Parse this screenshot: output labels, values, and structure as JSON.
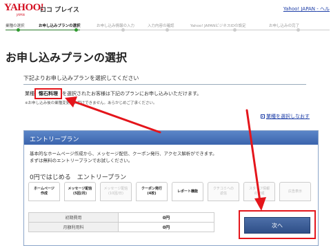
{
  "header": {
    "logo_main": "YAHOO!",
    "logo_sub": "JAPAN",
    "service_name": "ロコ プレイス",
    "yjapan_link": "Yahoo! JAPAN",
    "help_link": "- ヘル"
  },
  "steps": [
    {
      "label": "業種の選択",
      "state": "done"
    },
    {
      "label": "お申し込みプランの選択",
      "state": "current"
    },
    {
      "label": "お申し込み情報の入力",
      "state": "todo"
    },
    {
      "label": "入力内容の確認",
      "state": "todo"
    },
    {
      "label": "Yahoo! JAPANビジネスIDの設定",
      "state": "todo"
    },
    {
      "label": "お申し込みの完了",
      "state": "todo"
    }
  ],
  "page_title": "お申し込みプランの選択",
  "section_heading": "下記よりお申し込みプランを選択してください",
  "industry": {
    "prefix": "業種",
    "value": "懐石料理",
    "suffix": "を選択されたお客様は下記のプランにお申し込みいただけます。",
    "note": "※お申し込み後の業種変更はお受けできません。あらかじめご了承ください。"
  },
  "reselect_link": "業種を選択しなおす",
  "plan": {
    "header": "エントリープラン",
    "desc_line1": "基本的なホームページ作成から、メッセージ配信、クーポン発行、アクセス解析ができます。",
    "desc_line2": "まずは無料のエントリープランでお試しください。",
    "name": "0円ではじめる　エントリープラン",
    "features": [
      {
        "line1": "ホームページ",
        "line2": "作成",
        "enabled": true
      },
      {
        "line1": "メッセージ配信",
        "line2": "(5回/月)",
        "enabled": true
      },
      {
        "line1": "メッセージ配信",
        "line2": "(10回/日)",
        "enabled": false
      },
      {
        "line1": "クーポン発行",
        "line2": "(4枚)",
        "enabled": true
      },
      {
        "line1": "レポート機能",
        "line2": "",
        "enabled": true
      },
      {
        "line1": "クチコミへの",
        "line2": "返信",
        "enabled": false
      },
      {
        "line1": "スタッフ情報",
        "line2": "の作成",
        "enabled": false
      },
      {
        "line1": "広告表示",
        "line2": "",
        "enabled": false
      }
    ],
    "fees": [
      {
        "label": "初期費用",
        "value": "0円"
      },
      {
        "label": "月額利用料",
        "value": "0円"
      }
    ],
    "next_button": "次へ"
  },
  "colors": {
    "brand_red": "#d40f21",
    "annotation_red": "#e4151b",
    "link_blue": "#1a3ba6",
    "plan_header_blue": "#3b64ad",
    "step_green": "#2f9a2f"
  }
}
